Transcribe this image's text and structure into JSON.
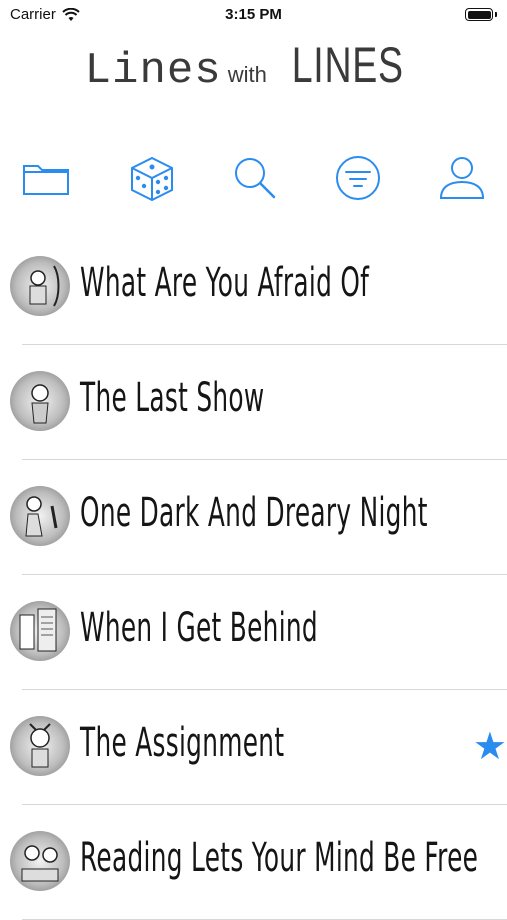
{
  "status": {
    "carrier": "Carrier",
    "time": "3:15 PM"
  },
  "title": {
    "part1": "Lines",
    "part2": "with",
    "part3": "LINES"
  },
  "toolbar": [
    {
      "name": "folder-icon"
    },
    {
      "name": "dice-icon"
    },
    {
      "name": "search-icon"
    },
    {
      "name": "filter-icon"
    },
    {
      "name": "profile-icon"
    }
  ],
  "poems": [
    {
      "title": "What Are You Afraid Of",
      "favorite": false
    },
    {
      "title": "The Last Show",
      "favorite": false
    },
    {
      "title": "One Dark And Dreary Night",
      "favorite": false
    },
    {
      "title": "When I Get Behind",
      "favorite": false
    },
    {
      "title": "The Assignment",
      "favorite": true
    },
    {
      "title": "Reading Lets Your Mind Be Free",
      "favorite": false
    }
  ],
  "colors": {
    "accent": "#2B8CEF"
  }
}
